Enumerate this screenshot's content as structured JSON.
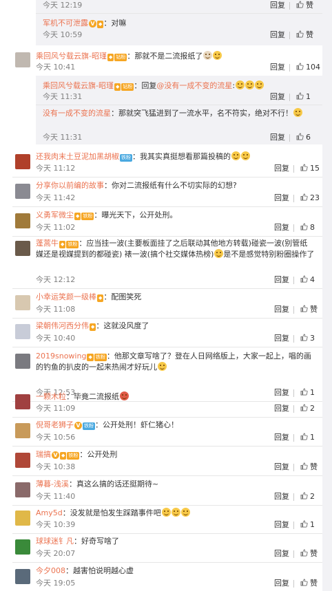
{
  "labels": {
    "reply": "回复",
    "like_label": "赞"
  },
  "comments": [
    {
      "kind": "sub",
      "time": "今天 12:19",
      "likes": "赞"
    },
    {
      "kind": "sub",
      "user": "军机不可泄露",
      "v": true,
      "fan": true,
      "text": "：对嘛",
      "time": "今天 10:59",
      "likes": "赞"
    },
    {
      "kind": "main",
      "user": "乘回风兮载云旗-昭瑾",
      "fan": true,
      "badge": "钻粉",
      "text": "：那就不是二流报纸了",
      "emojis": 2,
      "time": "今天 10:41",
      "likes": "104",
      "avatar": "#c0b8b0"
    },
    {
      "kind": "sub",
      "user": "乘回风兮载云旗-昭瑾",
      "fan": true,
      "badge": "钻粉",
      "text": "：回复",
      "mention": "@没有一成不变的流星",
      "text2": ":",
      "emojis": 3,
      "time": "今天 11:31",
      "likes": "1"
    },
    {
      "kind": "sub",
      "user": "没有一成不变的流星",
      "text": "：那就突飞猛进到了一流水平，名不符实，绝对不行！",
      "emojis": 1,
      "time": "今天 11:31",
      "likes": "6"
    },
    {
      "kind": "main",
      "user": "还我肉末土豆泥加黑胡椒",
      "badge": "铁粉",
      "text": "：我其实真挺想看那篇投稿的",
      "emojis": 2,
      "time": "今天 11:12",
      "likes": "15",
      "avatar": "#b0402a"
    },
    {
      "kind": "main",
      "user": "分享你以前编的故事",
      "text": "：你对二流报纸有什么不切实际的幻想?",
      "time": "今天 11:42",
      "likes": "23",
      "avatar": "#8a8a92"
    },
    {
      "kind": "main",
      "user": "义勇军微尘",
      "fan": true,
      "badge": "铁粉",
      "text": "：曝光天下，公开处刑。",
      "time": "今天 11:02",
      "likes": "8",
      "avatar": "#a07a3a"
    },
    {
      "kind": "main",
      "user": "蓬蒿牛",
      "fan": true,
      "badge": "铁粉",
      "text": "：应当挂一波(主要板面挂了之后联动其他地方转载)碰瓷一波(别管纸媒还是视媒提到的都碰瓷) 裱一波(搞个社交媒体热榜)",
      "emojis": 1,
      "text2": "是不是感觉特别粉圈操作了",
      "time": "今天 12:12",
      "likes": "4",
      "avatar": "#6a5a4a"
    },
    {
      "kind": "main",
      "user": "小幸运笑颜一级棒",
      "fan": true,
      "text": "：配图笑死",
      "time": "今天 11:08",
      "likes": "赞",
      "avatar": "#d8c8b0"
    },
    {
      "kind": "main",
      "user": "梁朝伟河西分伟",
      "fan": true,
      "text": "：这就没风度了",
      "time": "今天 10:40",
      "likes": "3",
      "avatar": "#c8ccd8"
    },
    {
      "kind": "main",
      "user": "2019snowing",
      "fan": true,
      "badge": "铁粉",
      "text": "：他那文章写啥了？登在人日网络版上，大家一起上，唱的画的钓鱼的扒皮的一起来热闹才好玩儿",
      "emojis": 1,
      "time": "今天 12:53",
      "likes": "1",
      "avatar": "#7a7a80"
    },
    {
      "kind": "main",
      "user": "一颗木粒",
      "text": "：毕竟二流报纸",
      "emojis": 1,
      "time": "今天 11:09",
      "likes": "2",
      "avatar": "#a04040"
    },
    {
      "kind": "main",
      "user": "倪哥老狮子",
      "v": true,
      "badge": "铁粉",
      "text": "：公开处刑！虾仁猪心！",
      "time": "今天 10:56",
      "likes": "1",
      "avatar": "#c89a5a"
    },
    {
      "kind": "main",
      "user": "瑞搞",
      "v": true,
      "fan": true,
      "badge": "铁粉",
      "text": "：公开处刑",
      "time": "今天 10:38",
      "likes": "赞",
      "avatar": "#b04838"
    },
    {
      "kind": "main",
      "user": "薄暮-浅溪",
      "text": "：真这么搞的话还挺期待~",
      "time": "今天 11:40",
      "likes": "2",
      "avatar": "#8a6a6a"
    },
    {
      "kind": "main",
      "user": "Amy5d",
      "text": "：没发就是怕发生踩踏事件吧",
      "emojis": 3,
      "time": "今天 10:39",
      "likes": "1",
      "avatar": "#e0b848"
    },
    {
      "kind": "main",
      "user": "球球迷钅凡",
      "text": "：好奇写啥了",
      "time": "今天 20:07",
      "likes": "赞",
      "avatar": "#3a8a3a"
    },
    {
      "kind": "main",
      "user": "今夕008",
      "text": "：越害怕说明越心虚",
      "time": "今天 19:05",
      "likes": "赞",
      "avatar": "#5a6a7a"
    }
  ]
}
